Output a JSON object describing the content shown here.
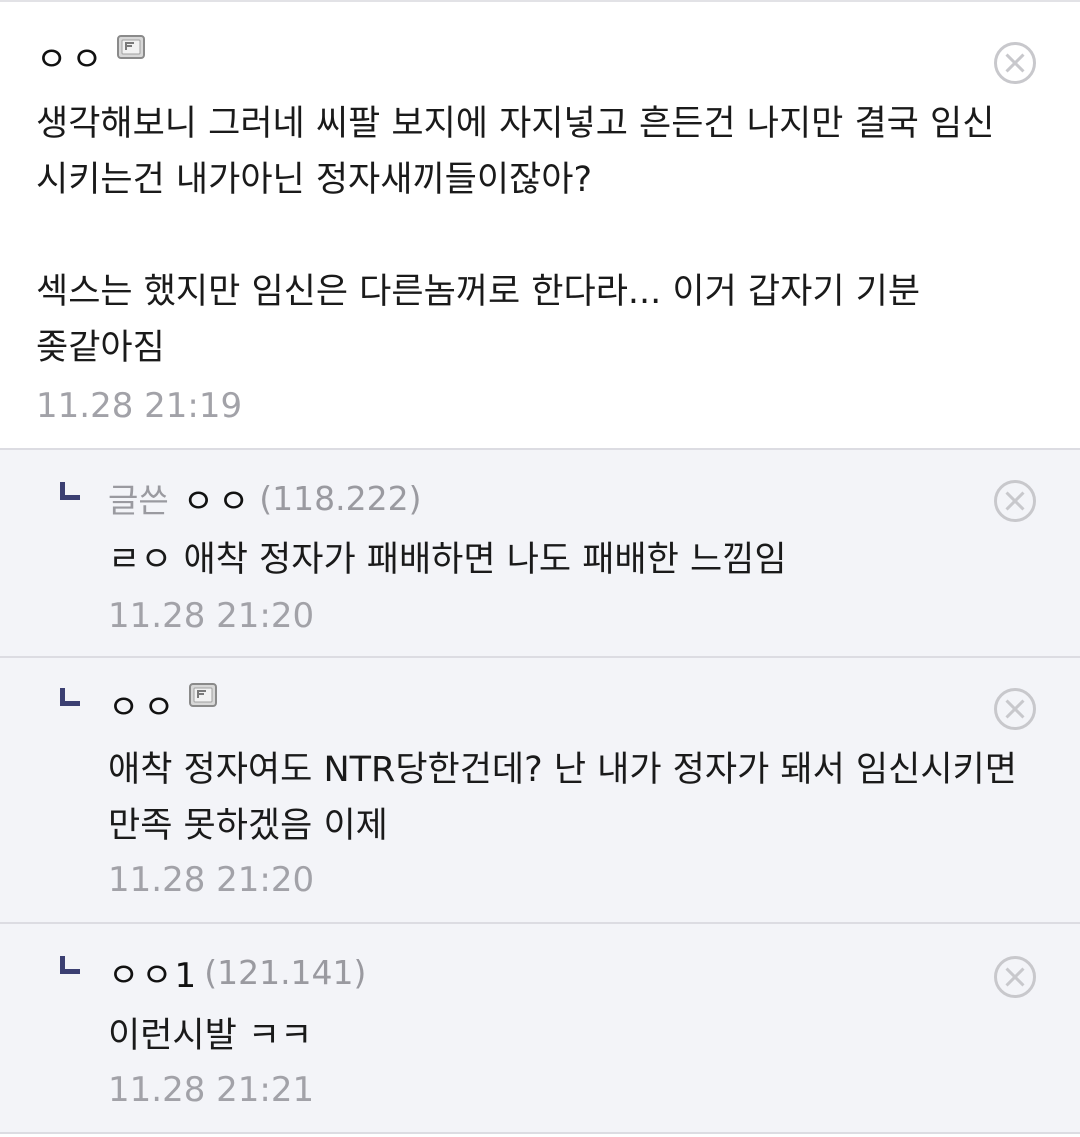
{
  "comments": [
    {
      "type": "main",
      "author": "ㅇㅇ",
      "fixed_nick_icon": "fixed-nick-icon",
      "text": "생각해보니 그러네 씨팔 보지에 자지넣고 흔든건 나지만 결국 임신 시키는건 내가아닌 정자새끼들이잖아?\n\n섹스는 했지만 임신은 다른놈꺼로 한다라... 이거 갑자기 기분 좆같아짐",
      "time": "11.28 21:19",
      "delete_icon": "delete-x-icon"
    },
    {
      "type": "reply",
      "writer_badge": "글쓴",
      "author": "ㅇㅇ",
      "ip": "(118.222)",
      "text": "ㄹㅇ 애착 정자가 패배하면 나도 패배한 느낌임",
      "time": "11.28 21:20",
      "delete_icon": "delete-x-icon"
    },
    {
      "type": "reply",
      "author": "ㅇㅇ",
      "fixed_nick_icon": "fixed-nick-icon",
      "text": "애착 정자여도 NTR당한건데? 난 내가 정자가 돼서 임신시키면 만족 못하겠음 이제",
      "time": "11.28 21:20",
      "delete_icon": "delete-x-icon"
    },
    {
      "type": "reply",
      "author": "ㅇㅇ1",
      "ip": "(121.141)",
      "text": "이런시발 ㅋㅋ",
      "time": "11.28 21:21",
      "delete_icon": "delete-x-icon"
    }
  ]
}
